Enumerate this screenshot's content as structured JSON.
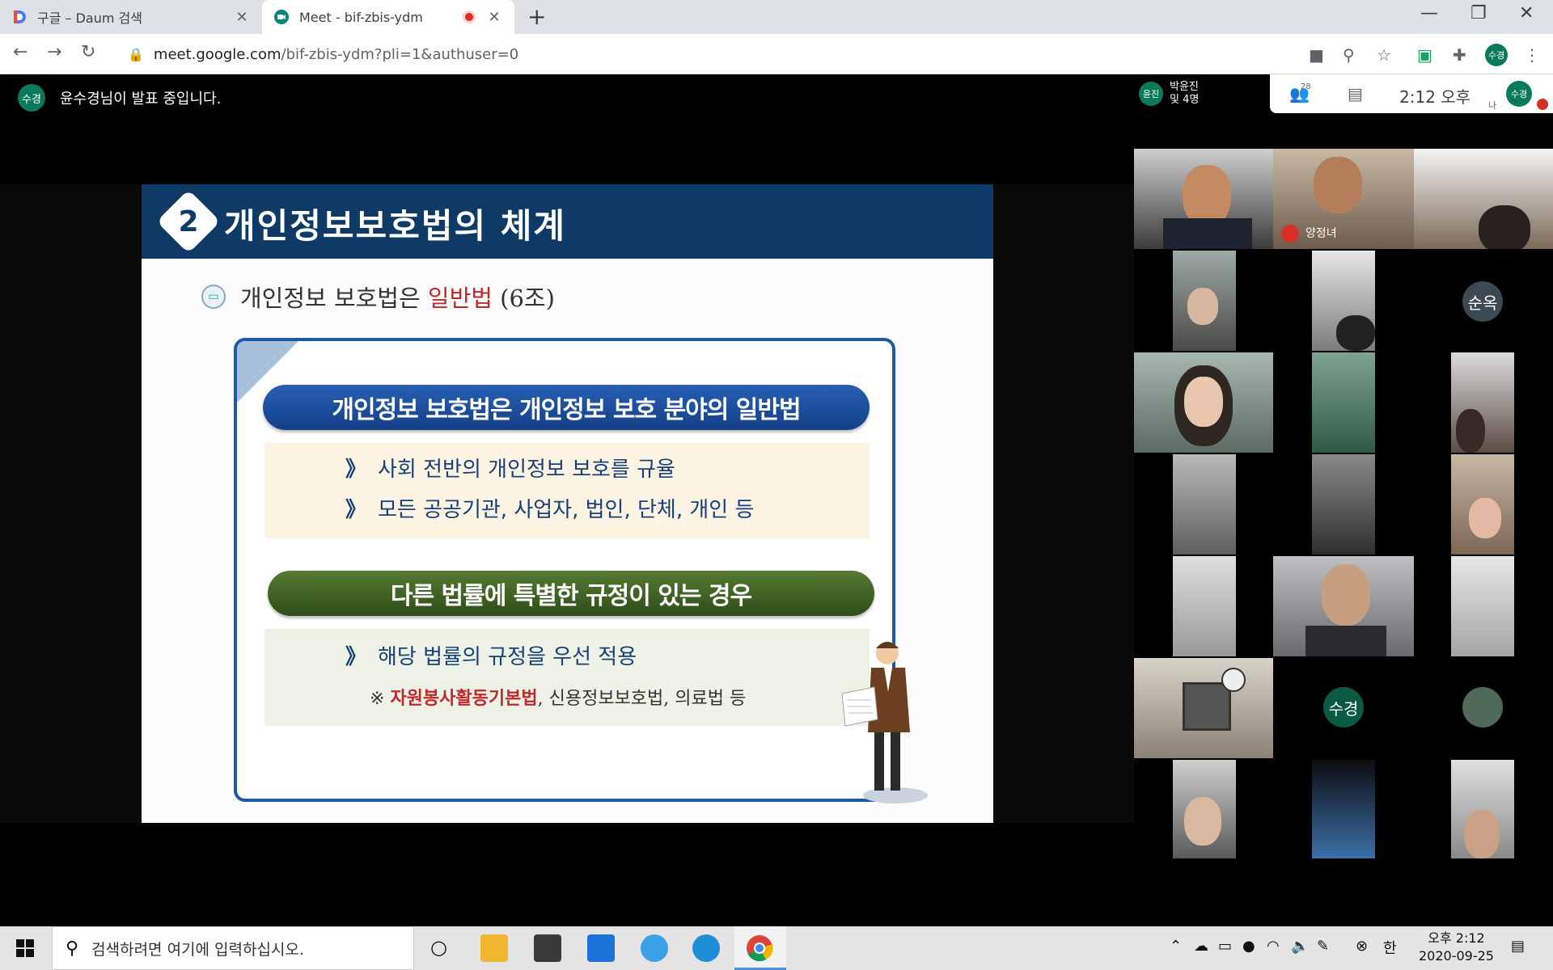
{
  "browser": {
    "tabs": [
      {
        "title": "구글 – Daum 검색",
        "active": false
      },
      {
        "title": "Meet - bif-zbis-ydm",
        "active": true,
        "recording": true
      }
    ],
    "new_tab_label": "+",
    "url_host": "meet.google.com",
    "url_path": "/bif-zbis-ydm?pli=1&authuser=0",
    "profile_initials": "수경"
  },
  "meet": {
    "presenter_avatar": "수경",
    "presenter_text": "윤수경님이 발표 중입니다.",
    "pinned": {
      "avatar": "윤진",
      "name_line1": "박윤진",
      "name_line2": "및 4명"
    },
    "participant_count": "28",
    "time": "2:12 오후",
    "self_label": "나",
    "self_avatar": "수경",
    "tiles": [
      {
        "label": "양정녀",
        "muted": true
      },
      {
        "avatar": "순옥",
        "avatar_color": "#3b4a52"
      },
      {
        "avatar": "수경",
        "avatar_color": "#0b5a44"
      }
    ]
  },
  "slide": {
    "number": "2",
    "title": "개인정보보호법의 체계",
    "subhead_prefix": "개인정보 보호법은 ",
    "subhead_red": "일반법",
    "subhead_suffix": " (6조)",
    "pill1": "개인정보 보호법은 개인정보 보호 분야의 일반법",
    "bullet1": "사회 전반의 개인정보 보호를 규율",
    "bullet2": "모든 공공기관, 사업자, 법인, 단체, 개인 등",
    "pill2": "다른 법률에 특별한 규정이 있는 경우",
    "bullet3": "해당 법률의 규정을 우선 적용",
    "note_prefix": "※ ",
    "note_red": "자원봉사활동기본법",
    "note_suffix": ", 신용정보보호법, 의료법 등",
    "chevron": "》"
  },
  "taskbar": {
    "search_placeholder": "검색하려면 여기에 입력하십시오.",
    "ime": "한",
    "clock_time": "오후 2:12",
    "clock_date": "2020-09-25"
  }
}
